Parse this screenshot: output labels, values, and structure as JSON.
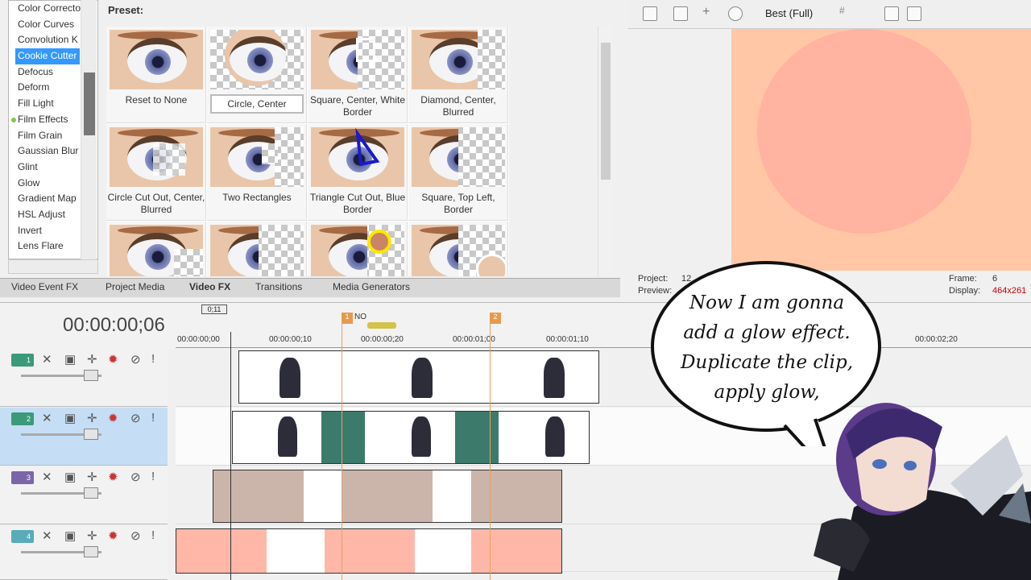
{
  "fx_list": {
    "items": [
      "Color Correcto",
      "Color Curves",
      "Convolution K",
      "Cookie Cutter",
      "Defocus",
      "Deform",
      "Fill Light",
      "Film Effects",
      "Film Grain",
      "Gaussian Blur",
      "Glint",
      "Glow",
      "Gradient Map",
      "HSL Adjust",
      "Invert",
      "Lens Flare"
    ],
    "selected": "Cookie Cutter",
    "marked": "Film Effects"
  },
  "preset": {
    "label": "Preset:",
    "items": [
      "Reset to None",
      "Circle, Center",
      "Square, Center, White Border",
      "Diamond, Center, Blurred",
      "Circle Cut Out, Center, Blurred",
      "Two Rectangles",
      "Triangle Cut Out, Blue Border",
      "Square, Top Left, Border"
    ],
    "selected": "Circle, Center"
  },
  "tabs": [
    "Video Event FX",
    "Project Media",
    "Video FX",
    "Transitions",
    "Media Generators"
  ],
  "active_tab": "Video FX",
  "preview": {
    "quality": "Best (Full)",
    "project_label": "Project:",
    "project_value": "12",
    "preview_label": "Preview:",
    "frame_label": "Frame:",
    "frame_value": "6",
    "display_label": "Display:",
    "display_value": "464x261"
  },
  "timeline": {
    "timecode": "00:00:00;06",
    "ruler": [
      "00:00:00;00",
      "00:00:00;10",
      "00:00:00;20",
      "00:00:01;00",
      "00:00:01;10",
      "00:00:02;20"
    ],
    "loop_label": "0;11",
    "marker_1": "1",
    "marker_2": "2",
    "marker_label": "NO",
    "tracks": [
      "1",
      "2",
      "3",
      "4"
    ]
  },
  "bubble": {
    "lines": [
      "Now I am gonna",
      "add a glow effect.",
      "Duplicate the clip,",
      "apply glow,"
    ]
  },
  "colors": {
    "selection": "#3399ff",
    "preview_bg": "#ffc7a6",
    "preview_circle": "#ffb3a0",
    "track_selected": "#c5def5",
    "clip_green": "#3c7a6c",
    "clip_beige": "#cbb5aa",
    "clip_pink": "#ffb8a8"
  }
}
